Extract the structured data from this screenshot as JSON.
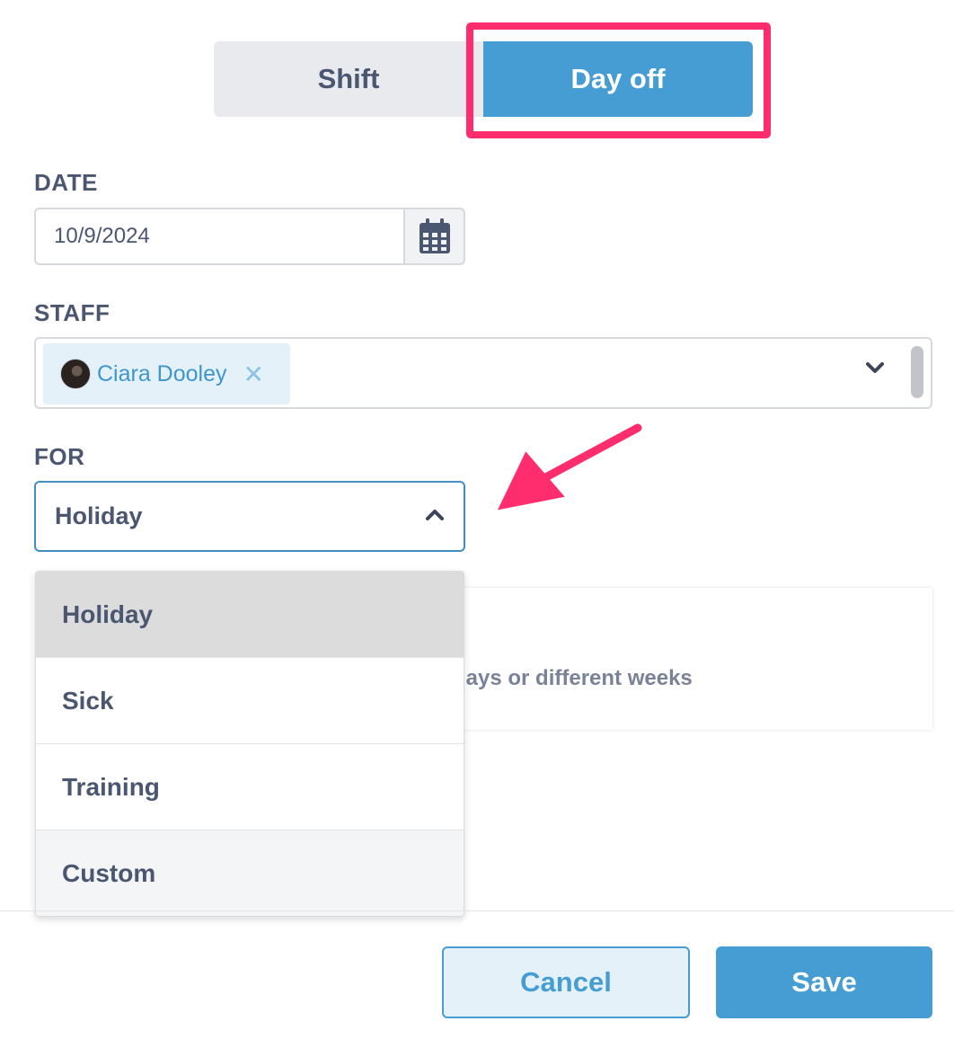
{
  "toggle": {
    "shift_label": "Shift",
    "dayoff_label": "Day off",
    "active": "Day off"
  },
  "date": {
    "label": "DATE",
    "value": "10/9/2024"
  },
  "staff": {
    "label": "STAFF",
    "selected": [
      {
        "name": "Ciara Dooley"
      }
    ]
  },
  "for_field": {
    "label": "FOR",
    "value": "Holiday",
    "options": [
      "Holiday",
      "Sick",
      "Training",
      "Custom"
    ]
  },
  "background_panel": {
    "partial_text": "lays or different weeks"
  },
  "footer": {
    "cancel_label": "Cancel",
    "save_label": "Save"
  },
  "colors": {
    "primary": "#469dd3",
    "highlight": "#ff2d6e",
    "text": "#4b5670"
  }
}
